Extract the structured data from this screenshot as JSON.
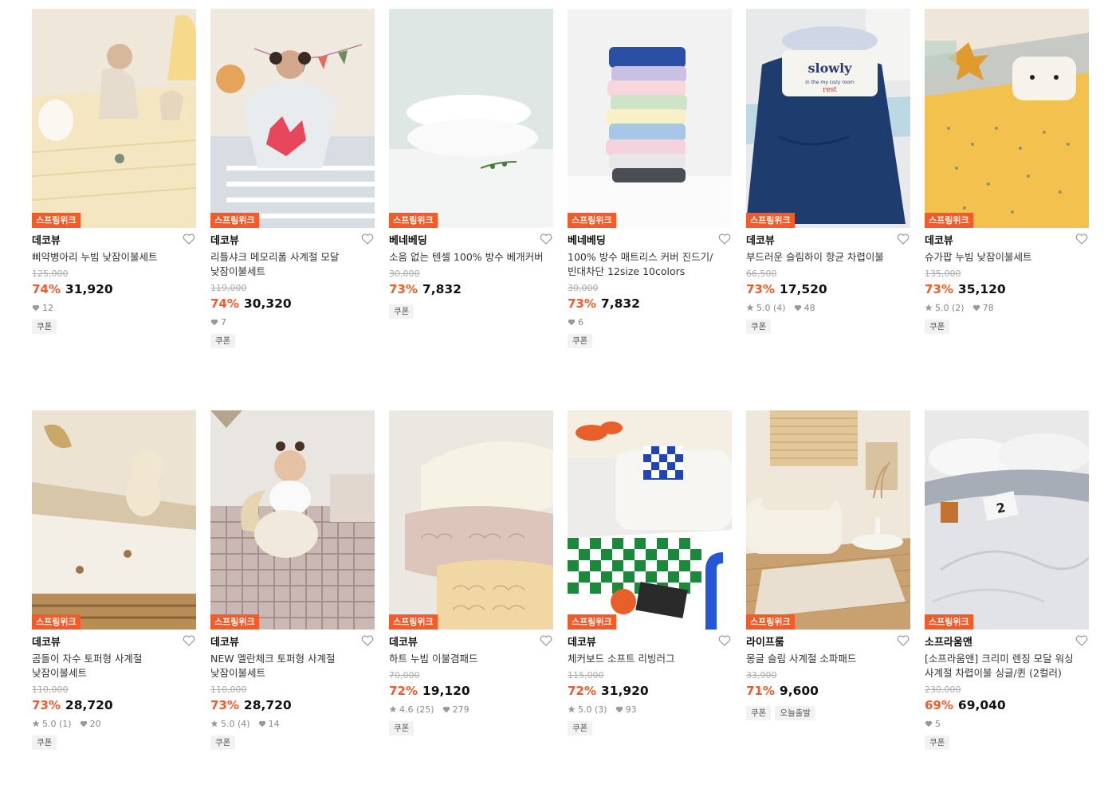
{
  "badge_label": "스프링위크",
  "tag_coupon": "쿠폰",
  "products": [
    {
      "brand": "데코뷰",
      "name": "삐약병아리 누빔 낮잠이불세트",
      "original_price": "125,000",
      "discount": "74%",
      "price": "31,920",
      "rating": "",
      "likes": "12",
      "tags": [
        "쿠폰"
      ]
    },
    {
      "brand": "데코뷰",
      "name": "리틀샤크 메모리폼 사계절 모달 낮잠이불세트",
      "original_price": "119,000",
      "discount": "74%",
      "price": "30,320",
      "rating": "",
      "likes": "7",
      "tags": [
        "쿠폰"
      ]
    },
    {
      "brand": "베네베딩",
      "name": "소음 없는 텐셀 100% 방수 베개커버",
      "original_price": "30,000",
      "discount": "73%",
      "price": "7,832",
      "rating": "",
      "likes": "",
      "tags": [
        "쿠폰"
      ]
    },
    {
      "brand": "베네베딩",
      "name": "100% 방수 매트리스 커버 진드기/빈대차단 12size 10colors",
      "original_price": "30,000",
      "discount": "73%",
      "price": "7,832",
      "rating": "",
      "likes": "6",
      "tags": [
        "쿠폰"
      ]
    },
    {
      "brand": "데코뷰",
      "name": "부드러운 슬림하이 항균 차렵이불",
      "original_price": "66,500",
      "discount": "73%",
      "price": "17,520",
      "rating": "5.0 (4)",
      "likes": "48",
      "tags": [
        "쿠폰"
      ]
    },
    {
      "brand": "데코뷰",
      "name": "슈가팝 누빔 낮잠이불세트",
      "original_price": "135,000",
      "discount": "73%",
      "price": "35,120",
      "rating": "5.0 (2)",
      "likes": "78",
      "tags": [
        "쿠폰"
      ]
    },
    {
      "brand": "데코뷰",
      "name": "곰돌이 자수 토퍼형 사계절 낮잠이불세트",
      "original_price": "110,000",
      "discount": "73%",
      "price": "28,720",
      "rating": "5.0 (1)",
      "likes": "20",
      "tags": [
        "쿠폰"
      ]
    },
    {
      "brand": "데코뷰",
      "name": "NEW 멜란체크 토퍼형 사계절 낮잠이불세트",
      "original_price": "110,000",
      "discount": "73%",
      "price": "28,720",
      "rating": "5.0 (4)",
      "likes": "14",
      "tags": [
        "쿠폰"
      ]
    },
    {
      "brand": "데코뷰",
      "name": "하트 누빔 이불겸패드",
      "original_price": "70,000",
      "discount": "72%",
      "price": "19,120",
      "rating": "4.6 (25)",
      "likes": "279",
      "tags": [
        "쿠폰"
      ]
    },
    {
      "brand": "데코뷰",
      "name": "체커보드 소프트 리빙러그",
      "original_price": "115,000",
      "discount": "72%",
      "price": "31,920",
      "rating": "5.0 (3)",
      "likes": "93",
      "tags": [
        "쿠폰"
      ]
    },
    {
      "brand": "라이프룸",
      "name": "몽글 슬림 사계절 소파패드",
      "original_price": "33,900",
      "discount": "71%",
      "price": "9,600",
      "rating": "",
      "likes": "",
      "tags": [
        "쿠폰",
        "오늘출발"
      ]
    },
    {
      "brand": "소프라움앤",
      "name": "[소프라움앤] 크리미 렌징 모달 워싱 사계절 차렵이불 싱글/퀸 (2컬러)",
      "original_price": "230,000",
      "discount": "69%",
      "price": "69,040",
      "rating": "",
      "likes": "5",
      "tags": [
        "쿠폰"
      ]
    }
  ]
}
